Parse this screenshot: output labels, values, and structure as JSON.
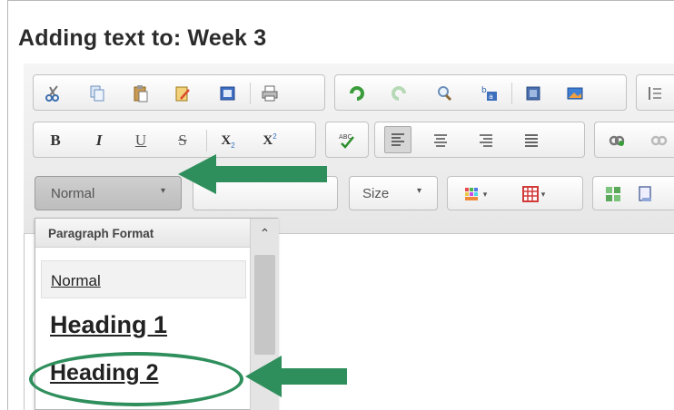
{
  "page": {
    "title": "Adding text to: Week 3"
  },
  "toolbar": {
    "row2": {
      "bold": "B",
      "italic": "I",
      "underline": "U",
      "strike": "S",
      "subscript": "X",
      "superscript": "X",
      "sub_mark": "2",
      "sup_mark": "2"
    },
    "format_combo": {
      "label": "Normal"
    },
    "size_combo": {
      "label": "Size"
    }
  },
  "dropdown": {
    "title": "Paragraph Format",
    "options": [
      {
        "label": "Normal"
      },
      {
        "label": "Heading 1"
      },
      {
        "label": "Heading 2"
      }
    ]
  },
  "colors": {
    "annotation": "#2f8f5c",
    "title": "#2b2b2b"
  },
  "icons": [
    "cut-icon",
    "copy-icon",
    "paste-icon",
    "paste-text-icon",
    "paste-word-icon",
    "print-icon",
    "undo-icon",
    "redo-icon",
    "find-icon",
    "replace-icon",
    "select-all-icon",
    "image-icon",
    "list-icon",
    "spellcheck-icon",
    "align-left-icon",
    "align-center-icon",
    "align-right-icon",
    "justify-icon",
    "link-icon",
    "unlink-icon",
    "text-color-icon",
    "table-icon",
    "show-blocks-icon",
    "maximize-icon"
  ]
}
